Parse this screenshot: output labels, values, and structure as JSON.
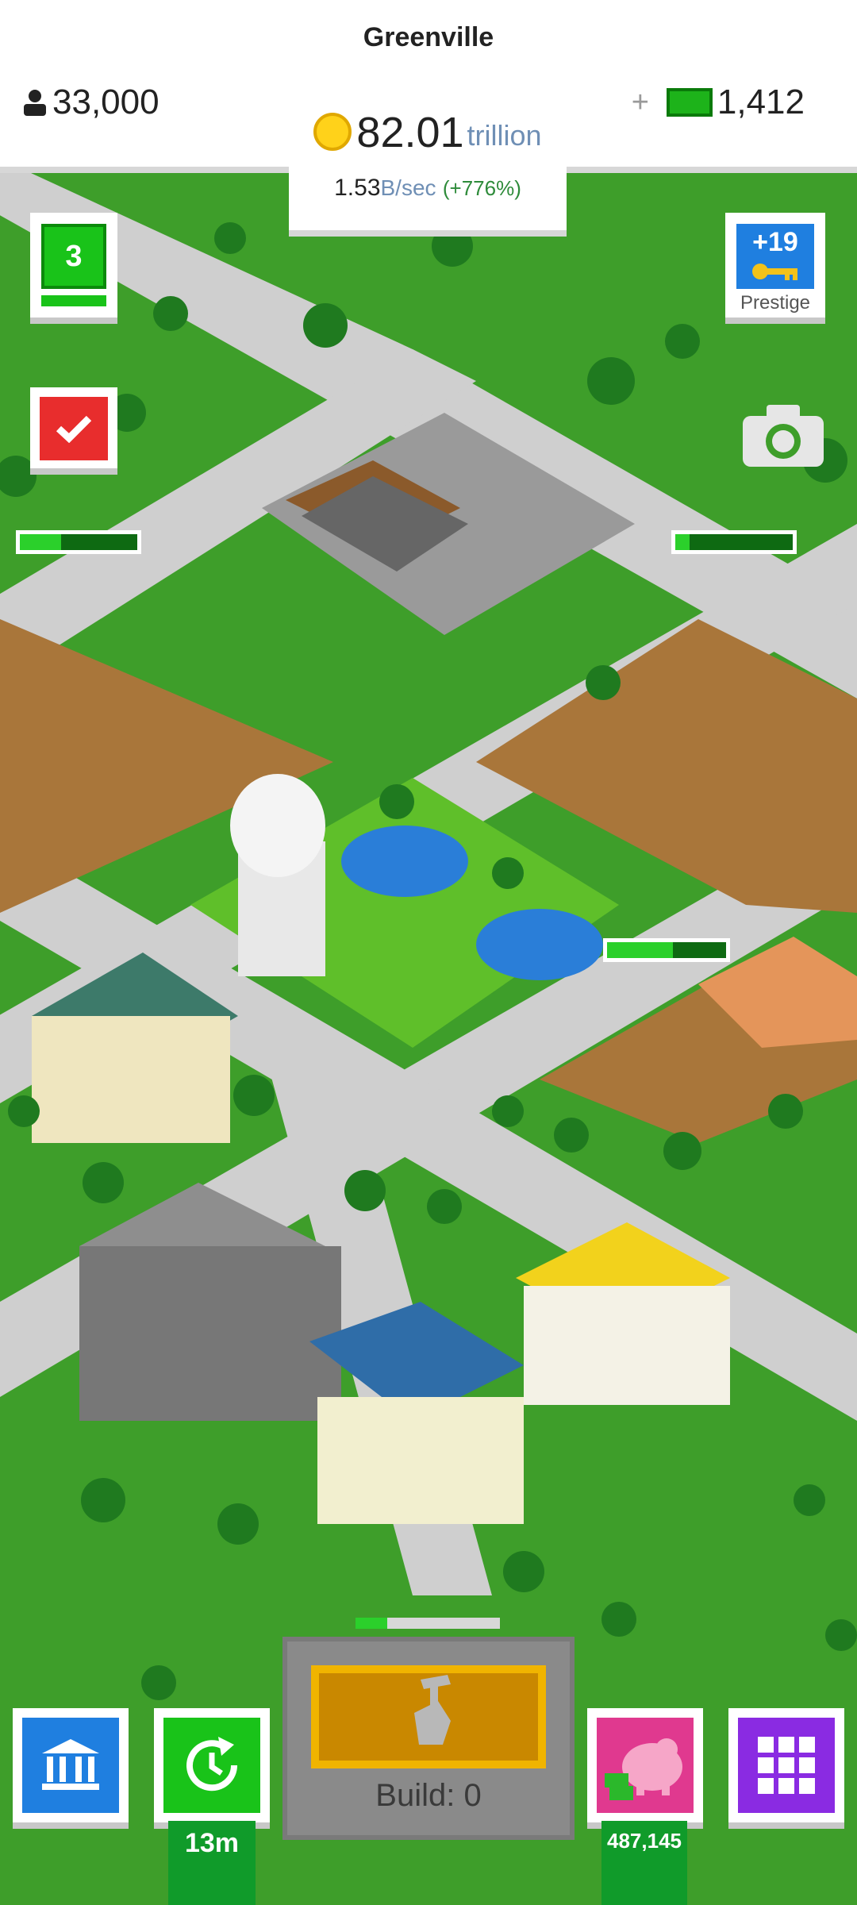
{
  "header": {
    "city_name": "Greenville",
    "population": "33,000",
    "coins_value": "82.01",
    "coins_unit": "trillion",
    "income_value": "1.53",
    "income_unit": "B/sec",
    "income_change": "(+776%)",
    "cash_plus": "+",
    "cash_value": "1,412"
  },
  "left_panel": {
    "level": "3",
    "level_progress": 1.0
  },
  "prestige": {
    "bonus": "+19",
    "label": "Prestige"
  },
  "map_progress": [
    {
      "id": "industrial",
      "fill": 0.35
    },
    {
      "id": "east-lot",
      "fill": 0.12
    },
    {
      "id": "suburb",
      "fill": 0.55
    }
  ],
  "bottom_bar": {
    "bank_icon": "bank-icon",
    "boost_timer": "13m",
    "build_label": "Build: 0",
    "build_progress": 0.22,
    "piggy_amount": "487,145",
    "menu_icon": "grid-icon"
  },
  "colors": {
    "grass": "#3e9e2a",
    "accent_green": "#19c319",
    "accent_red": "#e82d2d",
    "accent_blue": "#1f7fe0",
    "piggy_pink": "#e0398f",
    "menu_purple": "#8a2be2"
  }
}
